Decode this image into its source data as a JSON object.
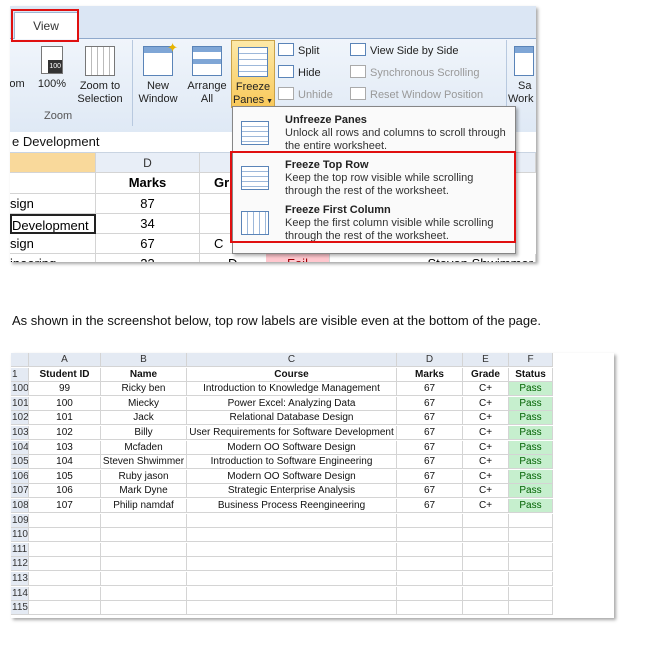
{
  "ribbon": {
    "tab_view": "View",
    "zoom_partial": "om",
    "zoom100": "100%",
    "zoom_to_selection": [
      "Zoom to",
      "Selection"
    ],
    "zoom_group": "Zoom",
    "new_window": [
      "New",
      "Window"
    ],
    "arrange_all": [
      "Arrange",
      "All"
    ],
    "freeze_panes": [
      "Freeze",
      "Panes"
    ],
    "split": "Split",
    "hide": "Hide",
    "unhide": "Unhide",
    "view_side_by_side": "View Side by Side",
    "synchronous_scrolling": "Synchronous Scrolling",
    "reset_window_position": "Reset Window Position",
    "save_workspace": [
      "Sa",
      "Work"
    ]
  },
  "formula_text": "e Development",
  "grid1": {
    "col_d": "D",
    "rows": [
      {
        "b": "",
        "d": "Marks",
        "e": "Gr"
      },
      {
        "b": "sign",
        "d": "87",
        "e": ""
      },
      {
        "b": "Development",
        "d": "34",
        "e": ""
      },
      {
        "b": "sign",
        "d": "67",
        "e": "C"
      },
      {
        "b": "ineering",
        "d": "23",
        "e": "D",
        "f": "Fail",
        "g": "Steven Shwimmer"
      }
    ]
  },
  "dropdown": {
    "items": [
      {
        "title": "Unfreeze Panes",
        "desc": "Unlock all rows and columns to scroll through the entire worksheet."
      },
      {
        "title": "Freeze Top Row",
        "desc": "Keep the top row visible while scrolling through the rest of the worksheet."
      },
      {
        "title": "Freeze First Column",
        "desc": "Keep the first column visible while scrolling through the rest of the worksheet."
      }
    ]
  },
  "caption": "As shown in the screenshot below, top row labels are visible even at the bottom of the page.",
  "sheet": {
    "columns": [
      "A",
      "B",
      "C",
      "D",
      "E",
      "F"
    ],
    "header_row_num": "1",
    "headers": [
      "Student ID",
      "Name",
      "Course",
      "Marks",
      "Grade",
      "Status"
    ],
    "rows": [
      {
        "num": "100",
        "cells": [
          "99",
          "Ricky ben",
          "Introduction to Knowledge Management",
          "67",
          "C+",
          "Pass"
        ]
      },
      {
        "num": "101",
        "cells": [
          "100",
          "Miecky",
          "Power Excel: Analyzing Data",
          "67",
          "C+",
          "Pass"
        ]
      },
      {
        "num": "102",
        "cells": [
          "101",
          "Jack",
          "Relational Database Design",
          "67",
          "C+",
          "Pass"
        ]
      },
      {
        "num": "103",
        "cells": [
          "102",
          "Billy",
          "User Requirements for Software Development",
          "67",
          "C+",
          "Pass"
        ]
      },
      {
        "num": "104",
        "cells": [
          "103",
          "Mcfaden",
          "Modern OO Software Design",
          "67",
          "C+",
          "Pass"
        ]
      },
      {
        "num": "105",
        "cells": [
          "104",
          "Steven Shwimmer",
          "Introduction to Software Engineering",
          "67",
          "C+",
          "Pass"
        ]
      },
      {
        "num": "106",
        "cells": [
          "105",
          "Ruby jason",
          "Modern OO Software Design",
          "67",
          "C+",
          "Pass"
        ]
      },
      {
        "num": "107",
        "cells": [
          "106",
          "Mark Dyne",
          "Strategic Enterprise Analysis",
          "67",
          "C+",
          "Pass"
        ]
      },
      {
        "num": "108",
        "cells": [
          "107",
          "Philip namdaf",
          "Business Process Reengineering",
          "67",
          "C+",
          "Pass"
        ]
      }
    ],
    "empty_rows": [
      "109",
      "110",
      "111",
      "112",
      "113",
      "114",
      "115"
    ]
  }
}
